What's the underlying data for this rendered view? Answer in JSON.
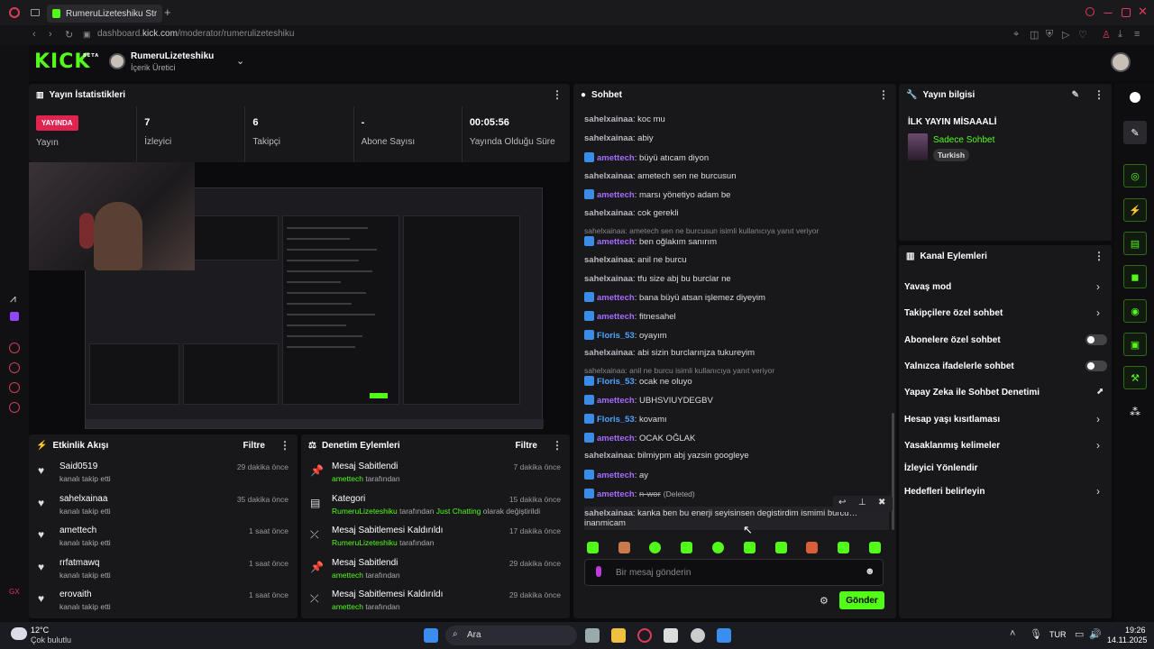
{
  "browser": {
    "tab_title": "RumeruLizeteshiku Strea",
    "url_prefix": "dashboard.",
    "url_domain": "kick.com",
    "url_path": "/moderator/rumerulizeteshiku"
  },
  "header": {
    "logo": "KICK",
    "logo_tag": "BETA",
    "channel_name": "RumeruLizeteshiku",
    "channel_role": "İçerik Üretici"
  },
  "stats_panel": {
    "title": "Yayın İstatistikleri",
    "live_badge": "YAYINDA",
    "live_label": "Yayın",
    "items": [
      {
        "value": "7",
        "label": "İzleyici"
      },
      {
        "value": "6",
        "label": "Takipçi"
      },
      {
        "value": "-",
        "label": "Abone Sayısı"
      },
      {
        "value": "00:05:56",
        "label": "Yayında Olduğu Süre"
      }
    ]
  },
  "activity": {
    "title": "Etkinlik Akışı",
    "filter": "Filtre",
    "items": [
      {
        "user": "Said0519",
        "sub": "kanalı takip etti",
        "time": "29 dakika önce"
      },
      {
        "user": "sahelxainaa",
        "sub": "kanalı takip etti",
        "time": "35 dakika önce"
      },
      {
        "user": "amettech",
        "sub": "kanalı takip etti",
        "time": "1 saat önce"
      },
      {
        "user": "rrfatmawq",
        "sub": "kanalı takip etti",
        "time": "1 saat önce"
      },
      {
        "user": "erovaith",
        "sub": "kanalı takip etti",
        "time": "1 saat önce"
      }
    ]
  },
  "moderation": {
    "title": "Denetim Eylemleri",
    "filter": "Filtre",
    "items": [
      {
        "title": "Mesaj Sabitlendi",
        "actor": "amettech",
        "rest": "tarafından",
        "extra": "",
        "extra2": "",
        "time": "7 dakika önce"
      },
      {
        "title": "Kategori",
        "actor": "RumeruLizeteshiku",
        "rest": "tarafından",
        "extra": "Just Chatting",
        "extra2": "olarak değiştirildi",
        "time": "15 dakika önce"
      },
      {
        "title": "Mesaj Sabitlemesi Kaldırıldı",
        "actor": "RumeruLizeteshiku",
        "rest": "tarafından",
        "extra": "",
        "extra2": "",
        "time": "17 dakika önce"
      },
      {
        "title": "Mesaj Sabitlendi",
        "actor": "amettech",
        "rest": "tarafından",
        "extra": "",
        "extra2": "",
        "time": "29 dakika önce"
      },
      {
        "title": "Mesaj Sabitlemesi Kaldırıldı",
        "actor": "amettech",
        "rest": "tarafından",
        "extra": "",
        "extra2": "",
        "time": "29 dakika önce"
      }
    ]
  },
  "chat": {
    "title": "Sohbet",
    "input_placeholder": "Bir mesaj gönderin",
    "send_label": "Gönder",
    "messages": [
      {
        "user": "sahelxainaa",
        "text": "koc mu"
      },
      {
        "user": "sahelxainaa",
        "text": "abiy"
      },
      {
        "user": "amettech",
        "text": "büyü atıcam diyon"
      },
      {
        "user": "sahelxainaa",
        "text": "ametech sen ne burcusun"
      },
      {
        "user": "amettech",
        "text": "marsı yönetiyo adam be"
      },
      {
        "user": "sahelxainaa",
        "text": "cok gerekli"
      },
      {
        "reply": "sahelxainaa: ametech sen ne burcusun isimli kullanıcıya yanıt veriyor"
      },
      {
        "user": "amettech",
        "text": "ben oğlakım sanırım"
      },
      {
        "user": "sahelxainaa",
        "text": "anil ne burcu"
      },
      {
        "user": "sahelxainaa",
        "text": "tfu size abj bu burclar ne"
      },
      {
        "user": "amettech",
        "text": "bana büyü atsan işlemez diyeyim"
      },
      {
        "user": "amettech",
        "text": "fitnesahel"
      },
      {
        "user": "Floris_53",
        "text": "oyayım"
      },
      {
        "user": "sahelxainaa",
        "text": "abi sizin burclarınjza tukureyim"
      },
      {
        "reply": "sahelxainaa: anil ne burcu isimli kullanıcıya yanıt veriyor"
      },
      {
        "user": "Floris_53",
        "text": "ocak ne oluyo"
      },
      {
        "user": "amettech",
        "text": "UBHSVIUYDEGBV"
      },
      {
        "user": "Floris_53",
        "text": "kovamı"
      },
      {
        "user": "amettech",
        "text": "OCAK OĞLAK"
      },
      {
        "user": "sahelxainaa",
        "text": "bilmiypm abj yazsin googleye"
      },
      {
        "user": "amettech",
        "text": "ay"
      },
      {
        "user": "amettech",
        "text": "n-wor",
        "deleted": "(Deleted)"
      },
      {
        "user": "sahelxainaa",
        "text": "kanka ben bu enerji seyisinsen degistirdim ismimi burcu…",
        "text2": "inanmicam"
      }
    ]
  },
  "stream_info": {
    "title": "Yayın bilgisi",
    "stream_title": "İLK YAYIN MİSAAALİ",
    "category": "Sadece Sohbet",
    "tag": "Turkish"
  },
  "channel_actions": {
    "title": "Kanal Eylemleri",
    "items": [
      {
        "label": "Yavaş mod",
        "control": "chevron"
      },
      {
        "label": "Takipçilere özel sohbet",
        "control": "chevron"
      },
      {
        "label": "Abonelere özel sohbet",
        "control": "toggle"
      },
      {
        "label": "Yalnızca ifadelerle sohbet",
        "control": "toggle"
      },
      {
        "label": "Yapay Zeka ile Sohbet Denetimi",
        "control": "external"
      },
      {
        "label": "Hesap yaşı kısıtlaması",
        "control": "chevron"
      },
      {
        "label": "Yasaklanmış kelimeler",
        "control": "chevron"
      },
      {
        "label": "İzleyici Yönlendir",
        "control": "none"
      },
      {
        "label": "Hedefleri belirleyin",
        "control": "chevron"
      }
    ]
  },
  "taskbar": {
    "weather_temp": "12°C",
    "weather_text": "Çok bulutlu",
    "search": "Ara",
    "lang": "TUR",
    "time": "19:26",
    "date": "14.11.2025"
  },
  "colors": {
    "accent": "#53fc18",
    "live": "#e0234f",
    "mod_user": "#a66cff",
    "vip_user": "#4aa6ff"
  }
}
